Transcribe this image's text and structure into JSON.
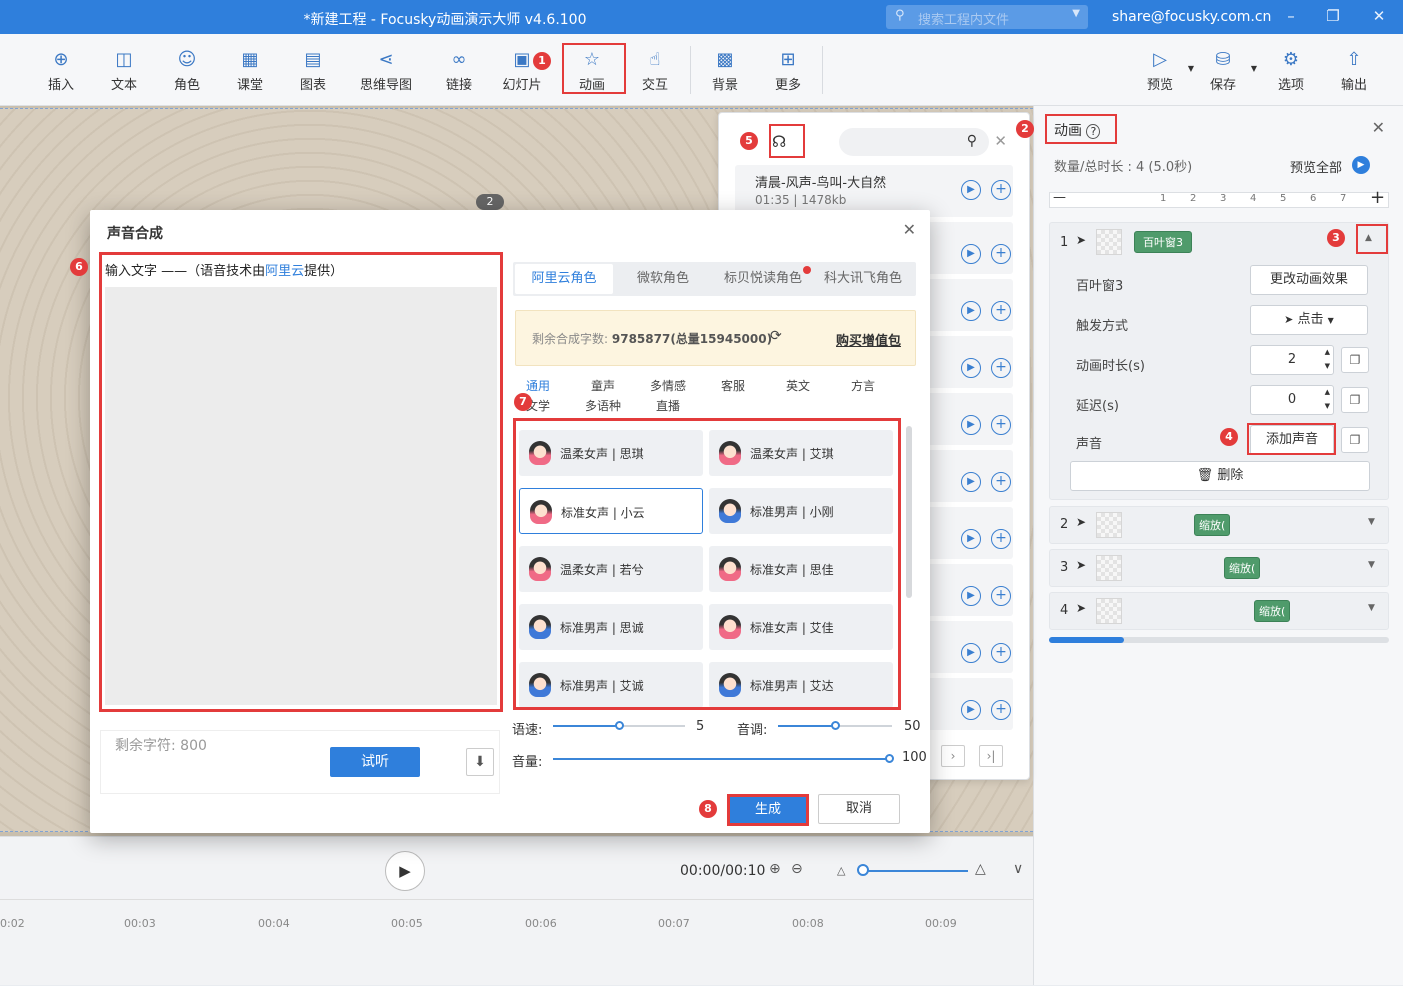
{
  "titlebar": {
    "title": "*新建工程 - Focusky动画演示大师  v4.6.100",
    "search_placeholder": "搜索工程内文件",
    "email": "share@focusky.com.cn"
  },
  "toolbar": {
    "items": [
      {
        "label": "插入",
        "icon": "plus-circle-icon"
      },
      {
        "label": "文本",
        "icon": "text-icon"
      },
      {
        "label": "角色",
        "icon": "person-icon"
      },
      {
        "label": "课堂",
        "icon": "classroom-icon"
      },
      {
        "label": "图表",
        "icon": "bar-chart-icon"
      },
      {
        "label": "思维导图",
        "icon": "mindmap-icon"
      },
      {
        "label": "链接",
        "icon": "link-icon"
      },
      {
        "label": "幻灯片",
        "icon": "slide-icon"
      },
      {
        "label": "动画",
        "icon": "star-icon"
      },
      {
        "label": "交互",
        "icon": "hand-icon"
      },
      {
        "label": "背景",
        "icon": "background-icon"
      },
      {
        "label": "更多",
        "icon": "grid-icon"
      }
    ],
    "right_items": [
      {
        "label": "预览",
        "icon": "play-icon"
      },
      {
        "label": "保存",
        "icon": "save-icon"
      },
      {
        "label": "选项",
        "icon": "gear-icon"
      },
      {
        "label": "输出",
        "icon": "export-icon"
      }
    ]
  },
  "canvas": {
    "page_badge": "2"
  },
  "timeline": {
    "time": "00:00/00:10",
    "ticks": [
      "0:02",
      "00:03",
      "00:04",
      "00:05",
      "00:06",
      "00:07",
      "00:08",
      "00:09"
    ]
  },
  "sound_library": {
    "items": [
      {
        "title": "清晨-风声-鸟叫-大自然",
        "meta": "01:35 | 1478kb"
      }
    ]
  },
  "right_panel": {
    "title": "动画",
    "count_label": "数量/总时长 : 4 (5.0秒)",
    "preview_all": "预览全部",
    "ruler_ticks": [
      "1",
      "2",
      "3",
      "4",
      "5",
      "6",
      "7"
    ],
    "anim1": {
      "index": "1",
      "chip": "百叶窗3",
      "effect_name": "百叶窗3",
      "change_effect": "更改动画效果",
      "trigger_label": "触发方式",
      "trigger_value": "点击",
      "duration_label": "动画时长(s)",
      "duration_value": "2",
      "delay_label": "延迟(s)",
      "delay_value": "0",
      "sound_label": "声音",
      "add_sound": "添加声音",
      "delete": "删除"
    },
    "others": [
      {
        "index": "2",
        "chip": "缩放("
      },
      {
        "index": "3",
        "chip": "缩放("
      },
      {
        "index": "4",
        "chip": "缩放("
      }
    ]
  },
  "dialog": {
    "title": "声音合成",
    "input_head_prefix": "输入文字 ——（语音技术由",
    "input_head_link": "阿里云",
    "input_head_suffix": "提供）",
    "remaining_chars": "剩余字符: 800",
    "listen": "试听",
    "tabs": [
      "阿里云角色",
      "微软角色",
      "标贝悦读角色",
      "科大讯飞角色"
    ],
    "quota_prefix": "剩余合成字数:",
    "quota_value": "9785877(总量15945000)",
    "buy": "购买增值包",
    "categories_row1": [
      "通用",
      "童声",
      "多情感",
      "客服",
      "英文",
      "方言"
    ],
    "categories_row2": [
      "文学",
      "多语种",
      "直播"
    ],
    "voices": [
      {
        "label": "温柔女声 | 思琪",
        "gender": "f"
      },
      {
        "label": "温柔女声 | 艾琪",
        "gender": "f"
      },
      {
        "label": "标准女声 | 小云",
        "gender": "f",
        "selected": true
      },
      {
        "label": "标准男声 | 小刚",
        "gender": "m"
      },
      {
        "label": "温柔女声 | 若兮",
        "gender": "f"
      },
      {
        "label": "标准女声 | 思佳",
        "gender": "f"
      },
      {
        "label": "标准男声 | 思诚",
        "gender": "m"
      },
      {
        "label": "标准女声 | 艾佳",
        "gender": "f"
      },
      {
        "label": "标准男声 | 艾诚",
        "gender": "m"
      },
      {
        "label": "标准男声 | 艾达",
        "gender": "m"
      }
    ],
    "speed_label": "语速:",
    "speed_value": "5",
    "pitch_label": "音调:",
    "pitch_value": "50",
    "volume_label": "音量:",
    "volume_value": "100",
    "generate": "生成",
    "cancel": "取消"
  },
  "markers": [
    "1",
    "2",
    "3",
    "4",
    "5",
    "6",
    "7",
    "8"
  ]
}
